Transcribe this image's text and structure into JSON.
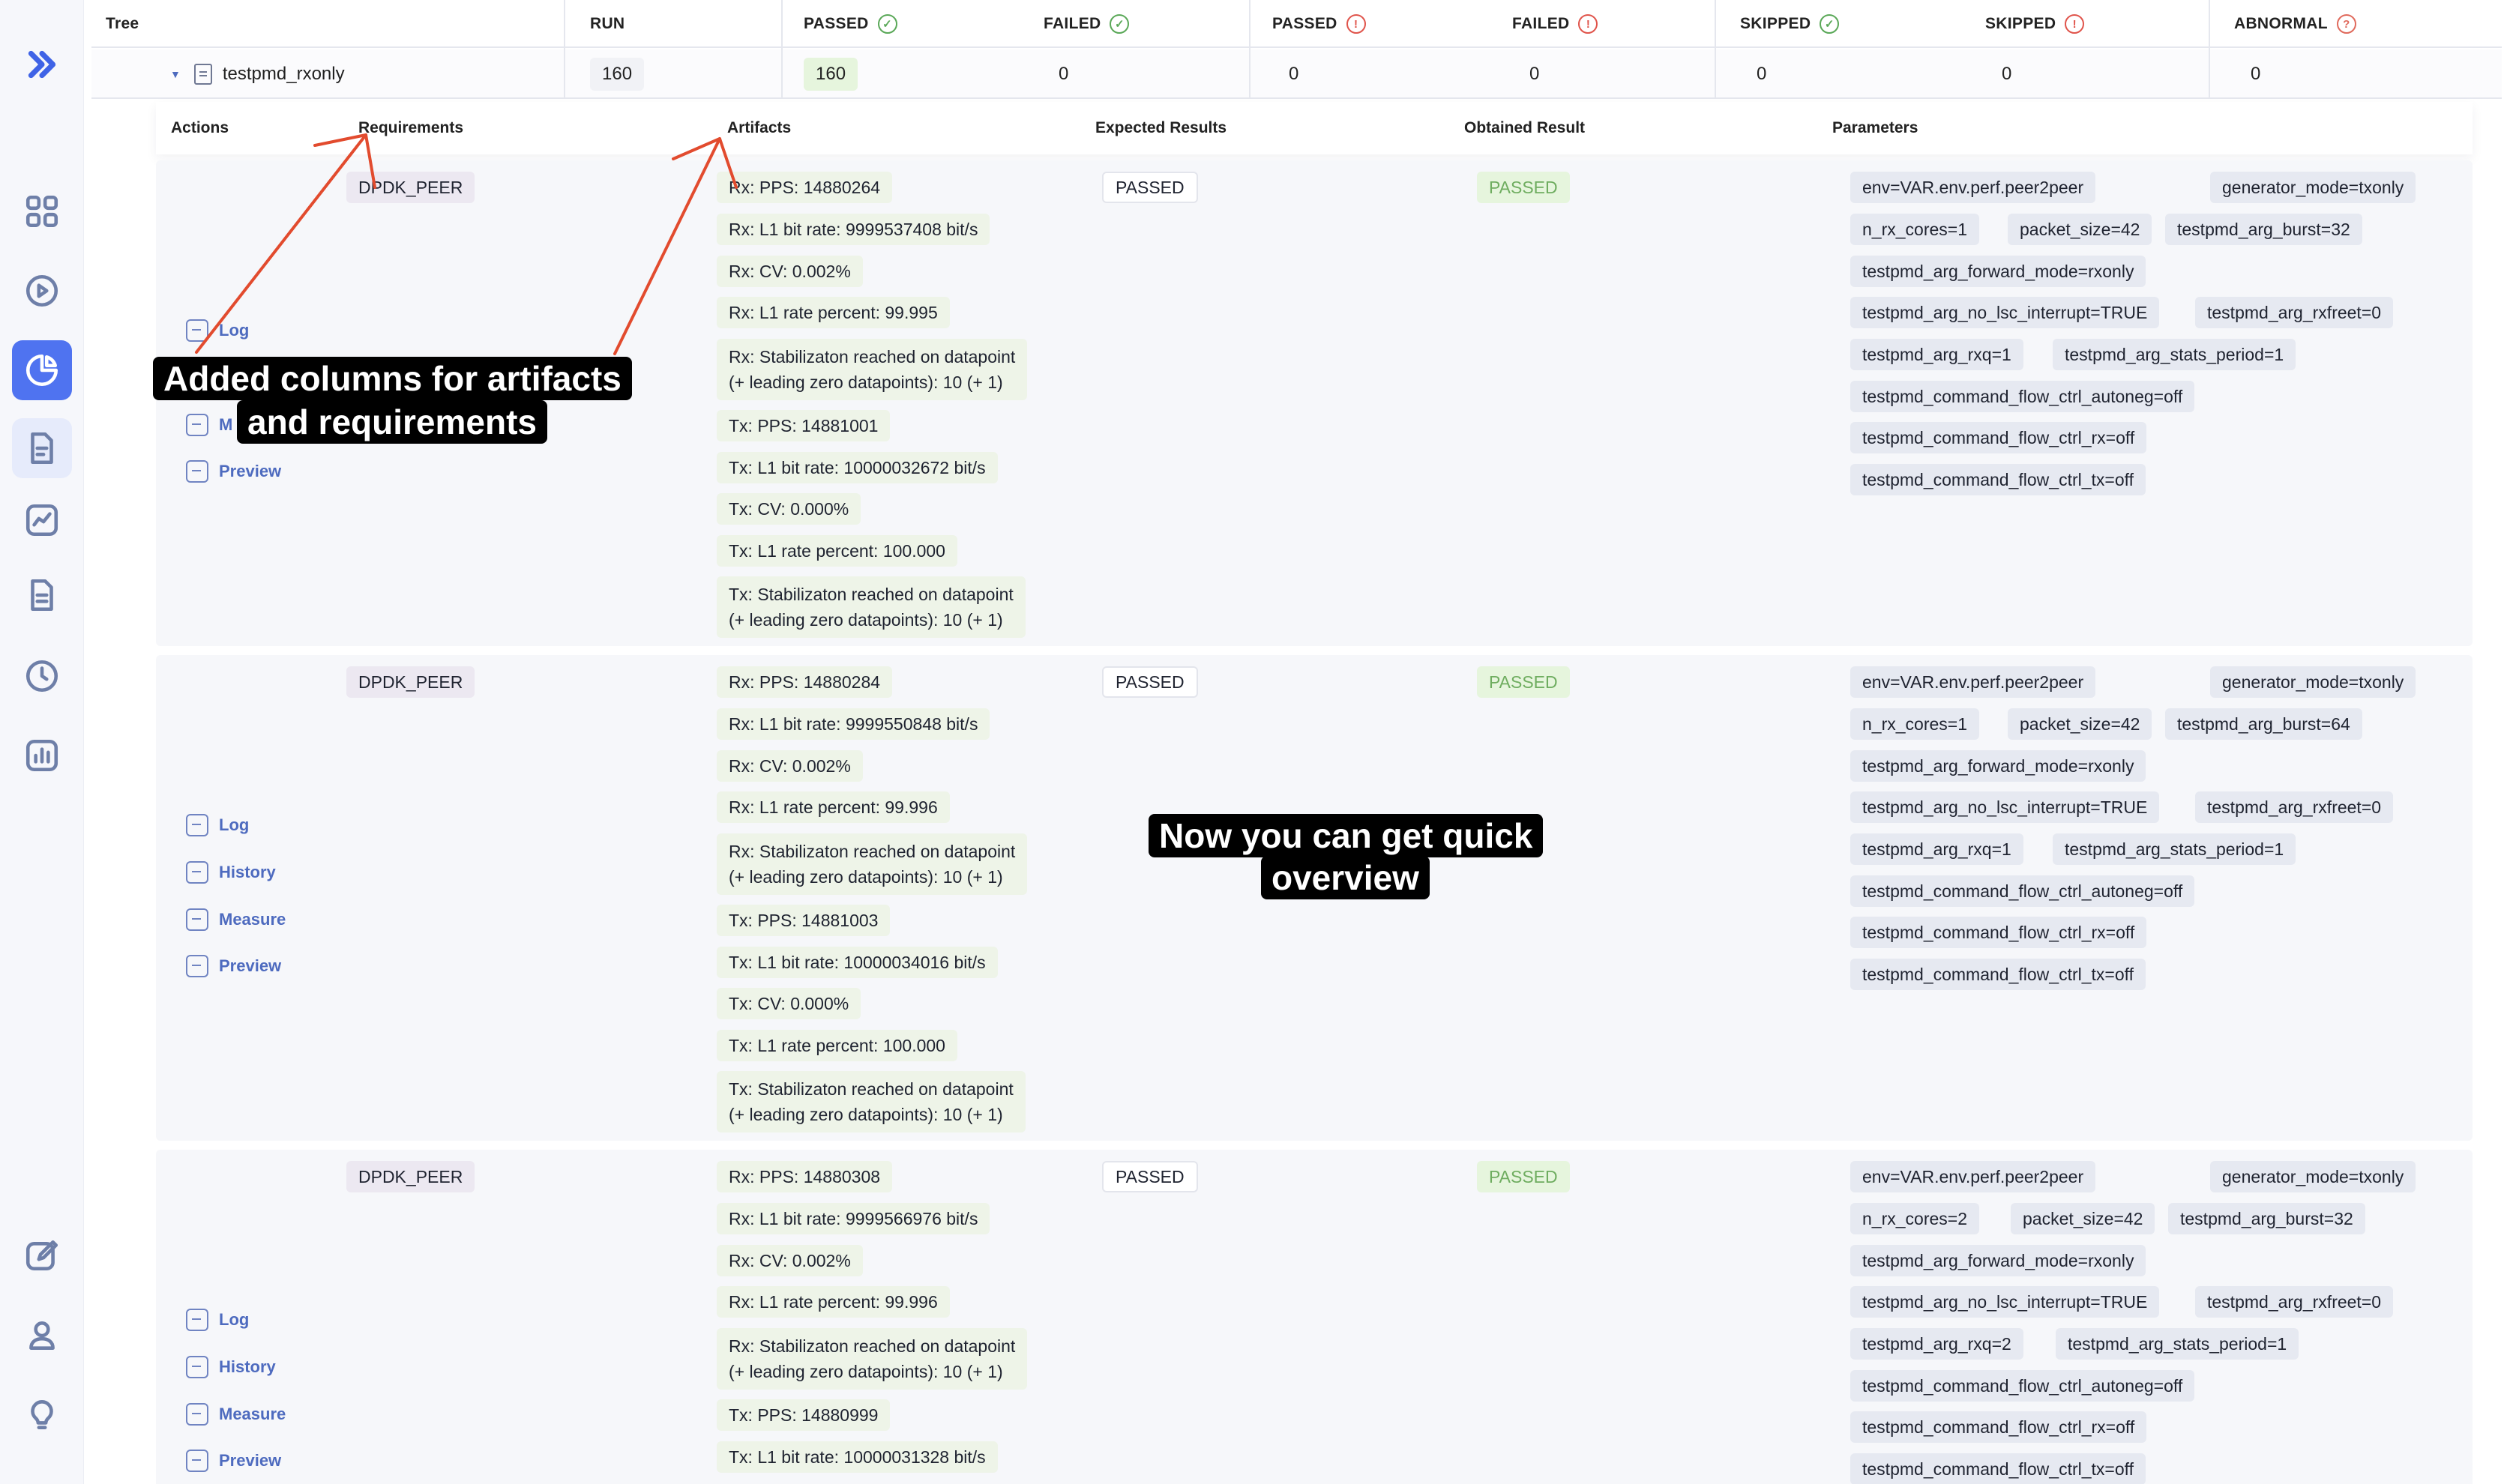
{
  "sidebar": {
    "icons": [
      "chevrons-right-icon",
      "grid-icon",
      "play-circle-icon",
      "pie-chart-icon",
      "document-icon",
      "trend-chart-icon",
      "file-text-icon",
      "clock-icon",
      "bar-chart-icon",
      "edit-icon",
      "user-icon",
      "lightbulb-icon"
    ]
  },
  "header": {
    "tree": "Tree",
    "run": "RUN",
    "passed_expected": "PASSED",
    "failed_expected": "FAILED",
    "passed_unexpected": "PASSED",
    "failed_unexpected": "FAILED",
    "skipped_expected": "SKIPPED",
    "skipped_unexpected": "SKIPPED",
    "abnormal": "ABNORMAL"
  },
  "row": {
    "name": "testpmd_rxonly",
    "run": "160",
    "passed_expected": "160",
    "failed_expected": "0",
    "passed_unexpected": "0",
    "failed_unexpected": "0",
    "skipped_expected": "0",
    "skipped_unexpected": "0",
    "abnormal": "0"
  },
  "details_header": {
    "actions": "Actions",
    "requirements": "Requirements",
    "artifacts": "Artifacts",
    "expected": "Expected Results",
    "obtained": "Obtained Result",
    "parameters": "Parameters"
  },
  "blocks": [
    {
      "requirement": "DPDK_PEER",
      "expected": "PASSED",
      "obtained": "PASSED",
      "actions": [
        "Log",
        "M",
        "Preview"
      ],
      "artifacts": [
        "Rx: PPS: 14880264",
        "Rx: L1 bit rate: 9999537408 bit/s",
        "Rx: CV: 0.002%",
        "Rx: L1 rate percent: 99.995",
        "Rx: Stabilizaton reached on datapoint",
        "(+ leading zero datapoints): 10 (+ 1)",
        "Tx: PPS: 14881001",
        "Tx: L1 bit rate: 10000032672 bit/s",
        "Tx: CV: 0.000%",
        "Tx: L1 rate percent: 100.000",
        "Tx: Stabilizaton reached on datapoint",
        "(+ leading zero datapoints): 10 (+ 1)"
      ],
      "params": [
        "env=VAR.env.perf.peer2peer",
        "generator_mode=txonly",
        "n_rx_cores=1",
        "packet_size=42",
        "testpmd_arg_burst=32",
        "testpmd_arg_forward_mode=rxonly",
        "testpmd_arg_no_lsc_interrupt=TRUE",
        "testpmd_arg_rxfreet=0",
        "testpmd_arg_rxq=1",
        "testpmd_arg_stats_period=1",
        "testpmd_command_flow_ctrl_autoneg=off",
        "testpmd_command_flow_ctrl_rx=off",
        "testpmd_command_flow_ctrl_tx=off"
      ]
    },
    {
      "requirement": "DPDK_PEER",
      "expected": "PASSED",
      "obtained": "PASSED",
      "actions": [
        "Log",
        "History",
        "Measure",
        "Preview"
      ],
      "artifacts": [
        "Rx: PPS: 14880284",
        "Rx: L1 bit rate: 9999550848 bit/s",
        "Rx: CV: 0.002%",
        "Rx: L1 rate percent: 99.996",
        "Rx: Stabilizaton reached on datapoint",
        "(+ leading zero datapoints): 10 (+ 1)",
        "Tx: PPS: 14881003",
        "Tx: L1 bit rate: 10000034016 bit/s",
        "Tx: CV: 0.000%",
        "Tx: L1 rate percent: 100.000",
        "Tx: Stabilizaton reached on datapoint",
        "(+ leading zero datapoints): 10 (+ 1)"
      ],
      "params": [
        "env=VAR.env.perf.peer2peer",
        "generator_mode=txonly",
        "n_rx_cores=1",
        "packet_size=42",
        "testpmd_arg_burst=64",
        "testpmd_arg_forward_mode=rxonly",
        "testpmd_arg_no_lsc_interrupt=TRUE",
        "testpmd_arg_rxfreet=0",
        "testpmd_arg_rxq=1",
        "testpmd_arg_stats_period=1",
        "testpmd_command_flow_ctrl_autoneg=off",
        "testpmd_command_flow_ctrl_rx=off",
        "testpmd_command_flow_ctrl_tx=off"
      ]
    },
    {
      "requirement": "DPDK_PEER",
      "expected": "PASSED",
      "obtained": "PASSED",
      "actions": [
        "Log",
        "History",
        "Measure",
        "Preview"
      ],
      "artifacts": [
        "Rx: PPS: 14880308",
        "Rx: L1 bit rate: 9999566976 bit/s",
        "Rx: CV: 0.002%",
        "Rx: L1 rate percent: 99.996",
        "Rx: Stabilizaton reached on datapoint",
        "(+ leading zero datapoints): 10 (+ 1)",
        "Tx: PPS: 14880999",
        "Tx: L1 bit rate: 10000031328 bit/s"
      ],
      "params": [
        "env=VAR.env.perf.peer2peer",
        "generator_mode=txonly",
        "n_rx_cores=2",
        "packet_size=42",
        "testpmd_arg_burst=32",
        "testpmd_arg_forward_mode=rxonly",
        "testpmd_arg_no_lsc_interrupt=TRUE",
        "testpmd_arg_rxfreet=0",
        "testpmd_arg_rxq=2",
        "testpmd_arg_stats_period=1",
        "testpmd_command_flow_ctrl_autoneg=off",
        "testpmd_command_flow_ctrl_rx=off",
        "testpmd_command_flow_ctrl_tx=off"
      ]
    }
  ],
  "annotations": {
    "a1_line1": "Added columns for artifacts",
    "a1_line2": "and requirements",
    "a2_line1": "Now you can get quick",
    "a2_line2": "overview"
  }
}
